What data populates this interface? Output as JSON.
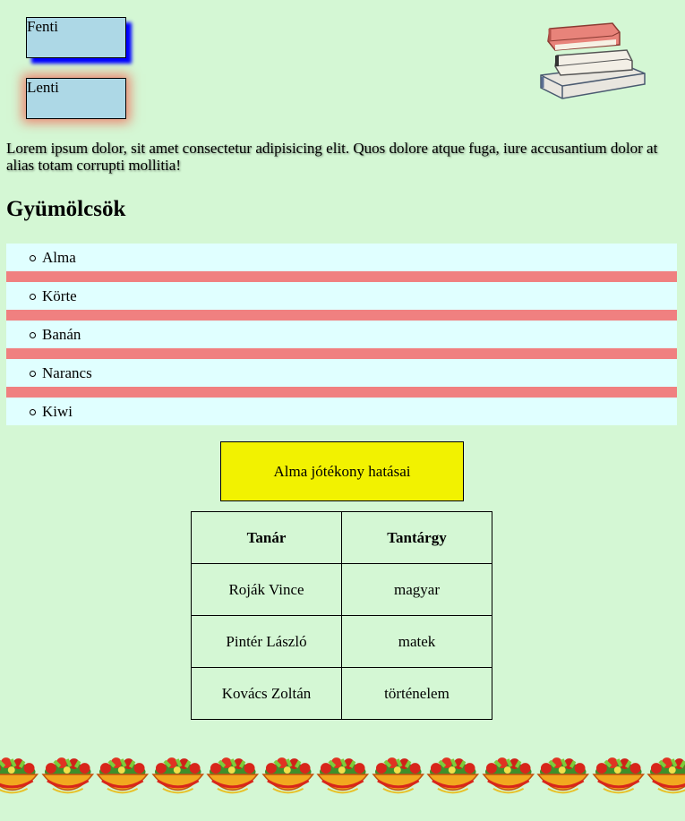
{
  "boxes": {
    "top_label": "Fenti",
    "bottom_label": "Lenti"
  },
  "intro_text": "Lorem ipsum dolor, sit amet consectetur adipisicing elit. Quos dolore atque fuga, iure accusantium dolor at alias totam corrupti mollitia!",
  "fruits": {
    "heading": "Gyümölcsök",
    "items": [
      "Alma",
      "Körte",
      "Banán",
      "Narancs",
      "Kiwi"
    ]
  },
  "highlight_box": {
    "label": "Alma jótékony hatásai"
  },
  "teacher_table": {
    "headers": [
      "Tanár",
      "Tantárgy"
    ],
    "rows": [
      [
        "Roják Vince",
        "magyar"
      ],
      [
        "Pintér László",
        "matek"
      ],
      [
        "Kovács Zoltán",
        "történelem"
      ]
    ]
  },
  "colors": {
    "background": "#d4f7d4",
    "box_fill": "#add8e6",
    "list_item": "#e0ffff",
    "list_separator": "#f08080",
    "highlight": "#f2f200"
  },
  "icons": {
    "books": "book-stack-icon",
    "salad": "salad-bowl-icon"
  }
}
